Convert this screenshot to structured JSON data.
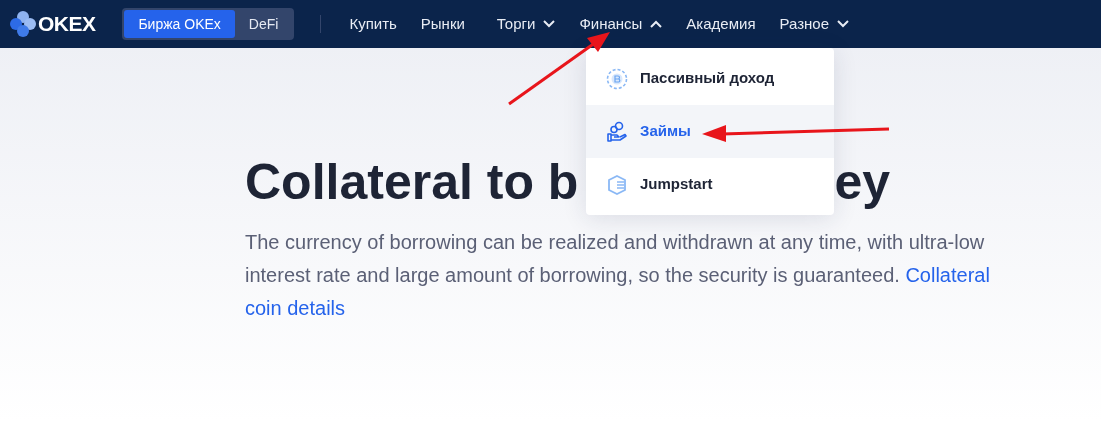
{
  "logo": {
    "text": "OKEX"
  },
  "segments": [
    {
      "label": "Биржа OKEx",
      "selected": true
    },
    {
      "label": "DeFi",
      "selected": false
    }
  ],
  "nav": [
    {
      "label": "Купить",
      "kind": "link"
    },
    {
      "label": "Рынки",
      "kind": "link"
    },
    {
      "label": "Торги",
      "kind": "menu",
      "expanded": false
    },
    {
      "label": "Финансы",
      "kind": "menu",
      "expanded": true
    },
    {
      "label": "Академия",
      "kind": "link"
    },
    {
      "label": "Разное",
      "kind": "menu",
      "expanded": false
    }
  ],
  "dropdown": [
    {
      "label": "Пассивный доход",
      "kind": "coin",
      "selected": false
    },
    {
      "label": "Займы",
      "kind": "hand",
      "selected": true
    },
    {
      "label": "Jumpstart",
      "kind": "shield",
      "selected": false
    }
  ],
  "hero": {
    "heading_start": "Collateral to b",
    "heading_end": "ey",
    "text": "The currency of borrowing can be realized and withdrawn at any time, with ultra-low interest rate and large amount of borrowing, so the security is guaranteed.",
    "link_lines": [
      "Collateral",
      "coin details"
    ]
  }
}
